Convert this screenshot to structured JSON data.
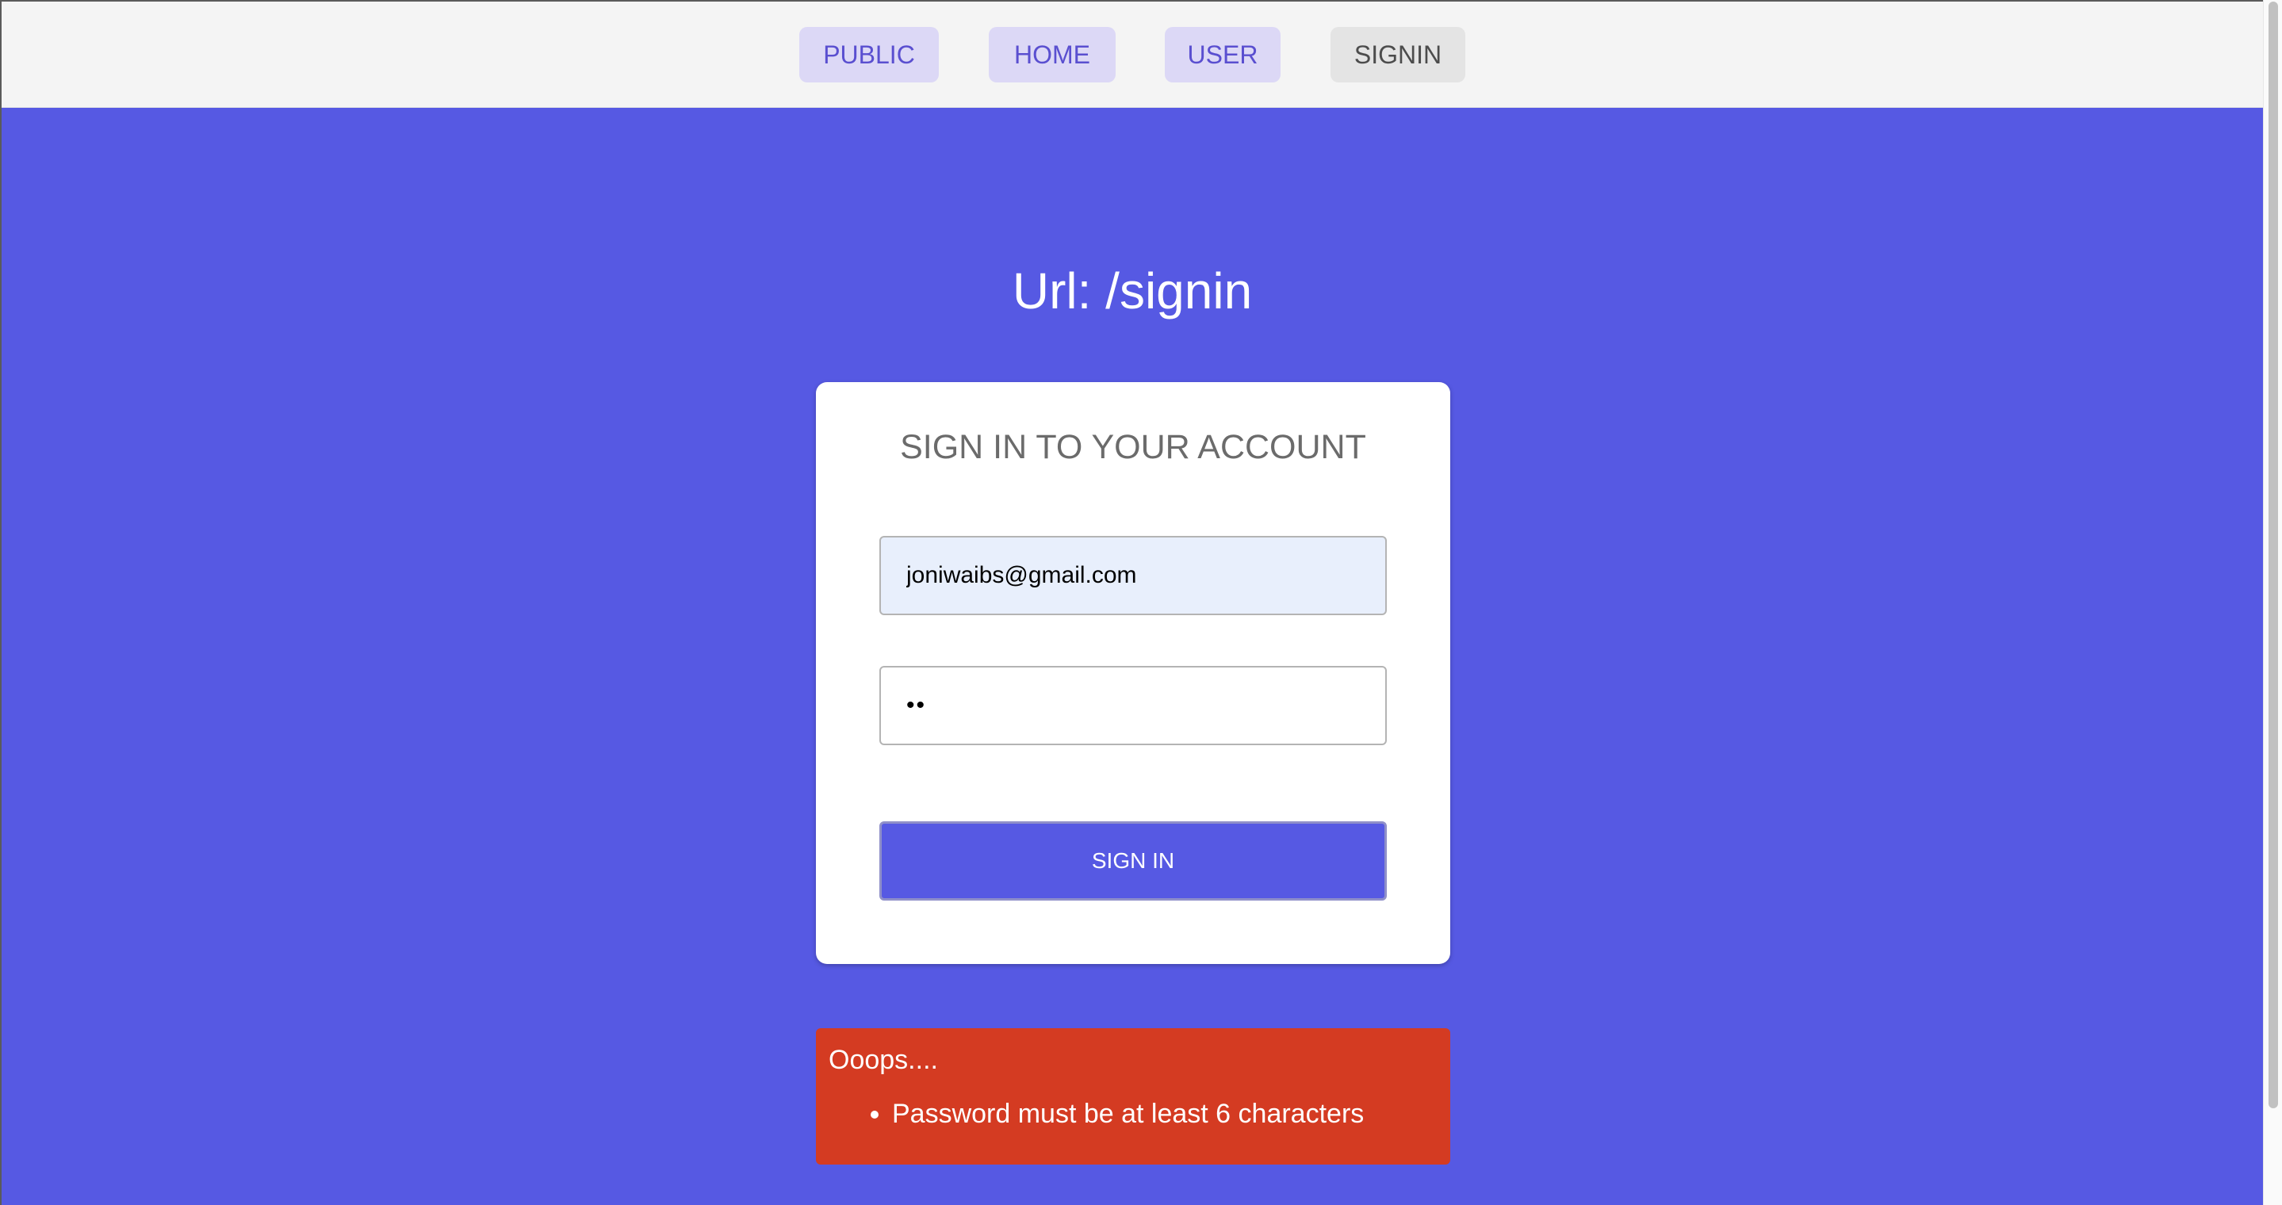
{
  "nav": {
    "links": [
      {
        "label": "PUBLIC"
      },
      {
        "label": "HOME"
      },
      {
        "label": "USER"
      },
      {
        "label": "SIGNIN"
      }
    ]
  },
  "page": {
    "url_title": "Url: /signin"
  },
  "signin_form": {
    "title": "SIGN IN TO YOUR ACCOUNT",
    "email_value": "joniwaibs@gmail.com",
    "password_value": "ab",
    "submit_label": "SIGN IN"
  },
  "error": {
    "title": "Ooops....",
    "messages": [
      "Password must be at least 6 characters"
    ]
  },
  "colors": {
    "page_background": "#5659e3",
    "nav_background": "#f4f4f4",
    "error_background": "#d43b22"
  }
}
